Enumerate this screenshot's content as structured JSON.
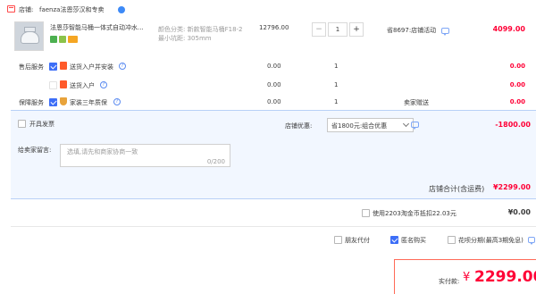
{
  "shop": {
    "prefix": "店铺:",
    "name": "faenza法恩莎汉和专卖"
  },
  "item": {
    "title": "法恩莎智能马桶一体式自动冲水...",
    "attrs": [
      "颜色分类: 新款智能马桶F18-2",
      "最小坑距: 305mm"
    ],
    "price": "12796.00",
    "qty": "1",
    "minus": "−",
    "plus": "+",
    "promo": "省8697:店铺活动",
    "subtotal": "4099.00"
  },
  "services": [
    {
      "group": "售后服务",
      "label": "送货入户并安装",
      "price": "0.00",
      "qty": "1",
      "note": "",
      "total": "0.00",
      "checked": true
    },
    {
      "group": "",
      "label": "送货入户",
      "price": "0.00",
      "qty": "1",
      "note": "",
      "total": "0.00",
      "checked": false
    },
    {
      "group": "保障服务",
      "label": "家装三年质保",
      "price": "0.00",
      "qty": "1",
      "note": "卖家赠送",
      "total": "0.00",
      "checked": true
    }
  ],
  "invoice": {
    "label": "开具发票"
  },
  "shop_discount": {
    "label": "店铺优惠:",
    "selected": "省1800元:组合优惠",
    "amount": "-1800.00"
  },
  "message": {
    "label": "给卖家留言:",
    "placeholder": "选填,请先和商家协商一致",
    "counter": "0/200"
  },
  "shop_total": {
    "label": "店铺合计(含运费)",
    "amount": "¥2299.00"
  },
  "coins": {
    "label": "使用2203淘金币抵扣22.03元",
    "amount": "¥0.00"
  },
  "options": [
    {
      "label": "朋友代付",
      "checked": false
    },
    {
      "label": "匿名购买",
      "checked": true
    },
    {
      "label": "花呗分期(最高3期免息)",
      "checked": false
    }
  ],
  "pay": {
    "label": "实付款:",
    "currency": "¥",
    "amount": "2299.00"
  },
  "colors": {
    "accent": "#ff0036",
    "panel": "#f2f7ff",
    "border": "#b8d0f7"
  }
}
